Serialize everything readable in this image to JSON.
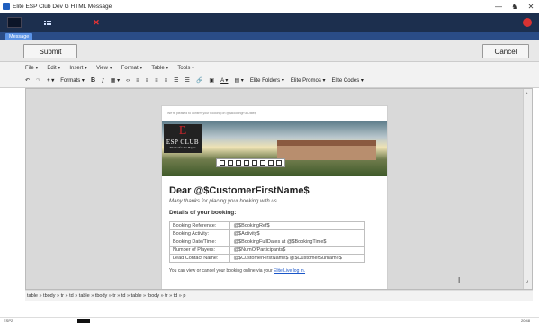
{
  "window": {
    "title": "Elite ESP Club Dev G HTML Message",
    "controls": [
      "—",
      "♞",
      "✕"
    ]
  },
  "app_tab": {
    "label": "Message"
  },
  "actions": {
    "submit": "Submit",
    "cancel": "Cancel"
  },
  "menu": {
    "items": [
      "File ▾",
      "Edit ▾",
      "Insert ▾",
      "View ▾",
      "Format ▾",
      "Table ▾",
      "Tools ▾"
    ]
  },
  "format_toolbar": {
    "formats": "Formats ▾",
    "bold": "B",
    "italic": "I",
    "elite_folders": "Elite Folders ▾",
    "elite_promos": "Elite Promos ▾",
    "elite_codes": "Elite Codes ▾"
  },
  "email": {
    "top_note": "We're pleased to confirm your booking on @$BookingFullDate$",
    "logo_letter": "E",
    "logo_name": "ESP CLUB",
    "logo_tag": "Take Golf to the Players",
    "heading": "Dear @$CustomerFirstName$",
    "thanks": "Many thanks for placing your booking with us.",
    "details_title": "Details of your booking:",
    "rows": [
      {
        "label": "Booking Reference:",
        "value": "@$BookingRef$"
      },
      {
        "label": "Booking Activity:",
        "value": "@$Activity$"
      },
      {
        "label": "Booking Date/Time:",
        "value": "@$BookingFullDates at @$BookingTime$"
      },
      {
        "label": "Number of Players:",
        "value": "@$NumOfParticipants$"
      },
      {
        "label": "Lead Contact Name:",
        "value": "@$CustomerFirstName$ @$CustomerSurname$"
      }
    ],
    "footer_text": "You can view or cancel your booking online via your ",
    "footer_link": "Elite Live log in."
  },
  "breadcrumb": "table » tbody » tr » td » table » tbody » tr » td » table » tbody » tr » td » p",
  "taskbar": {
    "left": "ESP2",
    "clock": "20:48"
  },
  "colors": {
    "toolbar_bg": "#1c2f4e",
    "tab": "#5b93e6",
    "link": "#1a56c8",
    "logo_red": "#c4252b"
  }
}
